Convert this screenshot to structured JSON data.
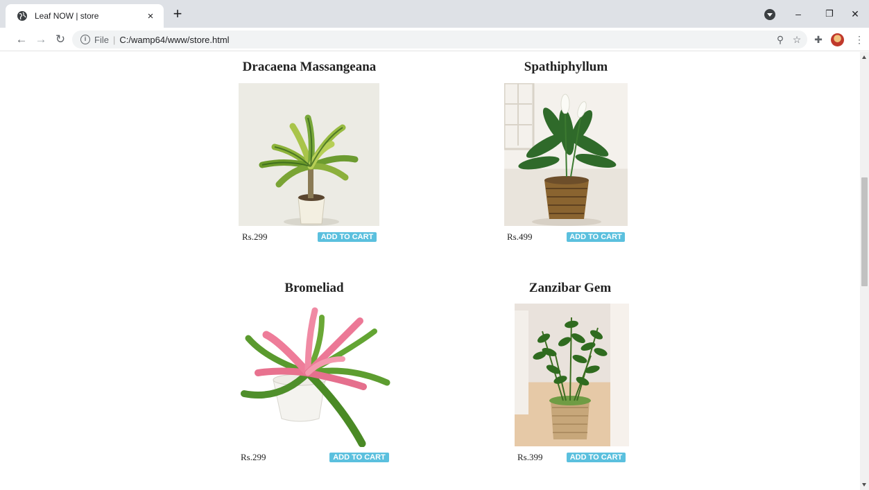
{
  "browser": {
    "tab_title": "Leaf NOW | store",
    "tab_close": "×",
    "new_tab": "+",
    "address_scheme": "File",
    "address_url": "C:/wamp64/www/store.html",
    "window_minimize": "–",
    "window_restore": "❐",
    "window_close": "✕"
  },
  "products": [
    {
      "name": "Dracaena Massangeana",
      "price": "Rs.299",
      "button": "ADD TO CART",
      "image": "dracaena-plant"
    },
    {
      "name": "Spathiphyllum",
      "price": "Rs.499",
      "button": "ADD TO CART",
      "image": "peace-lily-plant"
    },
    {
      "name": "Bromeliad",
      "price": "Rs.299",
      "button": "ADD TO CART",
      "image": "bromeliad-plant"
    },
    {
      "name": "Zanzibar Gem",
      "price": "Rs.399",
      "button": "ADD TO CART",
      "image": "zz-plant"
    }
  ],
  "colors": {
    "cart_button": "#5bc0de",
    "tabbar": "#dee1e6"
  }
}
